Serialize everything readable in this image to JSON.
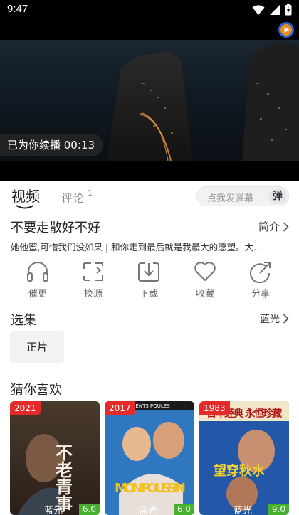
{
  "status_bar": {
    "time": "9:47"
  },
  "player": {
    "resume_text": "已为你续播 00:13"
  },
  "tabs": {
    "video": "视频",
    "comment": "评论",
    "comment_count": "1"
  },
  "danmu": {
    "placeholder": "点我发弹幕",
    "button": "弹"
  },
  "video": {
    "title": "不要走散好不好",
    "intro_label": "简介",
    "description": "她他蜜,可惜我们没如果 | 和你走到最后就是我最大的愿望。大…"
  },
  "actions": [
    {
      "label": "催更",
      "icon": "headphones-icon"
    },
    {
      "label": "换源",
      "icon": "switch-source-icon"
    },
    {
      "label": "下载",
      "icon": "download-icon"
    },
    {
      "label": "收藏",
      "icon": "heart-icon"
    },
    {
      "label": "分享",
      "icon": "share-icon"
    }
  ],
  "episodes": {
    "title": "选集",
    "quality": "蓝光",
    "items": [
      "正片"
    ]
  },
  "recommend": {
    "title": "猜你喜欢",
    "cards": [
      {
        "year": "2021",
        "quality": "蓝光",
        "score": "6.0",
        "poster_text": "不老青事",
        "colors": [
          "#3a2d24",
          "#8a6a4a"
        ]
      },
      {
        "year": "2017",
        "quality": "蓝光",
        "score": "6.0",
        "poster_text": "MON POUSSIN",
        "banner": "PARENTS POULES",
        "colors": [
          "#2a6fb0",
          "#e0b060"
        ]
      },
      {
        "year": "1983",
        "quality": "蓝光",
        "score": "9.0",
        "poster_text": "望穿秋水",
        "banner": "百年经典 永恒珍藏",
        "colors": [
          "#1f4f9a",
          "#c8a040"
        ]
      }
    ]
  },
  "colors": {
    "accent_red": "#e52a2a",
    "score_green": "#45b12c"
  }
}
